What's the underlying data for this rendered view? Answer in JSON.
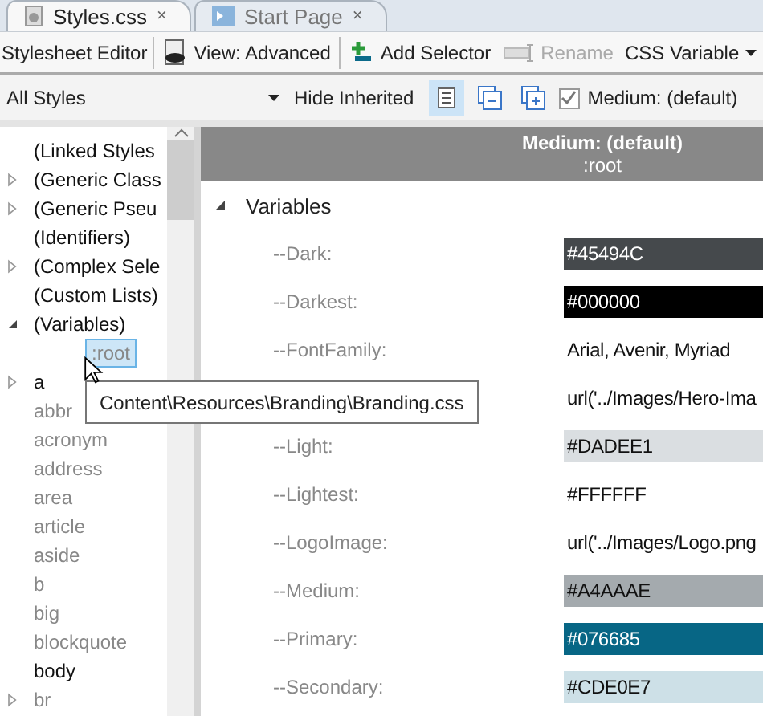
{
  "tabs": [
    {
      "label": "Styles.css",
      "close": "×",
      "selected": true
    },
    {
      "label": "Start Page",
      "close": "×",
      "selected": false
    }
  ],
  "toolbar": {
    "title": "Stylesheet Editor",
    "items": [
      {
        "label": "View: Advanced",
        "kind": "eye",
        "disabled": false
      },
      {
        "label": "Add Selector",
        "kind": "add",
        "disabled": false
      },
      {
        "label": "Rename",
        "kind": "rename",
        "disabled": true
      },
      {
        "label": "CSS Variable",
        "kind": "dropdown",
        "disabled": false
      }
    ]
  },
  "filter": {
    "scope": "All Styles",
    "hide_inherited": "Hide Inherited",
    "view_buttons": [
      {
        "kind": "list",
        "selected": true
      },
      {
        "kind": "collapse",
        "selected": false
      },
      {
        "kind": "expand",
        "selected": false
      }
    ],
    "medium": {
      "label": "Medium: (default)",
      "checked": true
    }
  },
  "tree": [
    {
      "label": "(Linked Styles",
      "used": true
    },
    {
      "label": "(Generic Class",
      "used": true,
      "expanded": false
    },
    {
      "label": "(Generic Pseu",
      "used": true,
      "expanded": false
    },
    {
      "label": "(Identifiers)",
      "used": true
    },
    {
      "label": "(Complex Sele",
      "used": true,
      "expanded": false
    },
    {
      "label": "(Custom Lists)",
      "used": true
    },
    {
      "label": "(Variables)",
      "used": true,
      "expanded": true,
      "children": [
        {
          "label": ":root",
          "used": false,
          "selected": true
        }
      ]
    },
    {
      "label": "a",
      "used": true,
      "expanded": false
    },
    {
      "label": "abbr",
      "used": false
    },
    {
      "label": "acronym",
      "used": false
    },
    {
      "label": "address",
      "used": false
    },
    {
      "label": "area",
      "used": false
    },
    {
      "label": "article",
      "used": false
    },
    {
      "label": "aside",
      "used": false
    },
    {
      "label": "b",
      "used": false
    },
    {
      "label": "big",
      "used": false
    },
    {
      "label": "blockquote",
      "used": false
    },
    {
      "label": "body",
      "used": true
    },
    {
      "label": "br",
      "used": false,
      "expanded": false
    }
  ],
  "tooltip": "Content\\Resources\\Branding\\Branding.css",
  "header": {
    "medium": "Medium: (default)",
    "selector": ":root"
  },
  "section": {
    "label": "Variables",
    "expanded": true
  },
  "variables": [
    {
      "name": "--Dark:",
      "value": "#45494C",
      "kind": "swatch",
      "color": "#45494c"
    },
    {
      "name": "--Darkest:",
      "value": "#000000",
      "kind": "swatch",
      "color": "#000000"
    },
    {
      "name": "--FontFamily:",
      "value": "Arial, Avenir, Myriad",
      "kind": "text"
    },
    {
      "value": "url('../Images/Hero-Ima",
      "kind": "text"
    },
    {
      "name": "--Light:",
      "value": "#DADEE1",
      "kind": "swatch",
      "color": "#dadee1"
    },
    {
      "name": "--Lightest:",
      "value": "#FFFFFF",
      "kind": "swatch",
      "color": "#ffffff"
    },
    {
      "name": "--LogoImage:",
      "value": "url('../Images/Logo.png",
      "kind": "text"
    },
    {
      "name": "--Medium:",
      "value": "#A4AAAE",
      "kind": "swatch",
      "color": "#a4aaae"
    },
    {
      "name": "--Primary:",
      "value": "#076685",
      "kind": "swatch",
      "color": "#076685"
    },
    {
      "name": "--Secondary:",
      "value": "#CDE0E7",
      "kind": "swatch",
      "color": "#cde0e7"
    }
  ]
}
